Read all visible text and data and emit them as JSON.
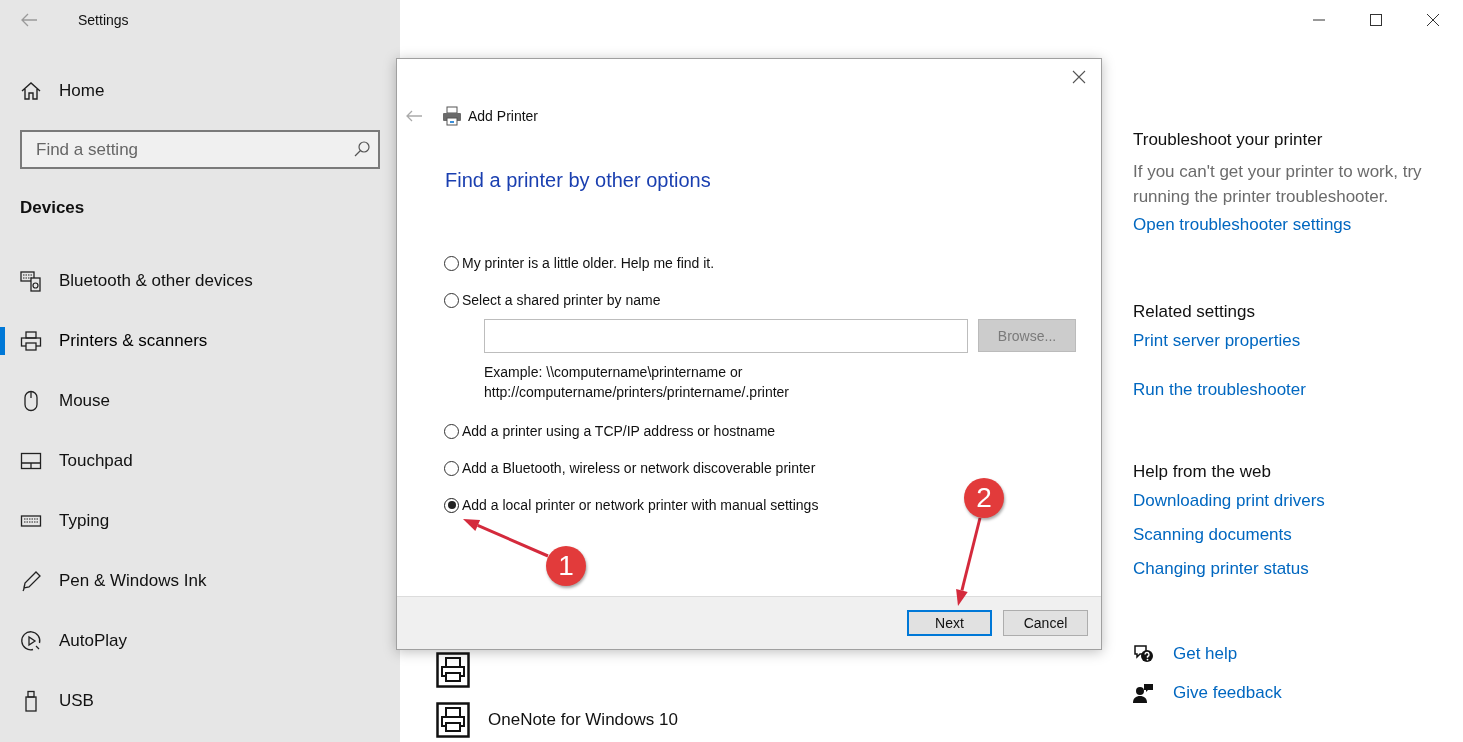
{
  "window": {
    "title": "Settings"
  },
  "sidebar": {
    "home": "Home",
    "search": {
      "placeholder": "Find a setting"
    },
    "section": "Devices",
    "items": [
      {
        "label": "Bluetooth & other devices",
        "selected": false
      },
      {
        "label": "Printers & scanners",
        "selected": true
      },
      {
        "label": "Mouse",
        "selected": false
      },
      {
        "label": "Touchpad",
        "selected": false
      },
      {
        "label": "Typing",
        "selected": false
      },
      {
        "label": "Pen & Windows Ink",
        "selected": false
      },
      {
        "label": "AutoPlay",
        "selected": false
      },
      {
        "label": "USB",
        "selected": false
      }
    ]
  },
  "printers": [
    {
      "kind": "covered"
    },
    {
      "kind": "listed",
      "name": "OneNote for Windows 10"
    }
  ],
  "right_panel": {
    "sections": [
      {
        "heading": "Troubleshoot your printer",
        "text": "If you can't get your printer to work, try running the printer troubleshooter.",
        "links": [
          "Open troubleshooter settings"
        ]
      },
      {
        "heading": "Related settings",
        "links": [
          "Print server properties",
          "Run the troubleshooter"
        ]
      },
      {
        "heading": "Help from the web",
        "links": [
          "Downloading print drivers",
          "Scanning documents",
          "Changing printer status"
        ]
      }
    ],
    "help": [
      {
        "label": "Get help"
      },
      {
        "label": "Give feedback"
      }
    ]
  },
  "dialog": {
    "title": "Add Printer",
    "heading": "Find a printer by other options",
    "options": [
      {
        "kind": "radio",
        "label": "My printer is a little older. Help me find it.",
        "selected": false
      },
      {
        "kind": "radio_with_field",
        "label": "Select a shared printer by name",
        "selected": false,
        "browse": {
          "label": "Browse...",
          "disabled": true
        },
        "example": [
          "Example: \\\\computername\\printername or",
          "http://computername/printers/printername/.printer"
        ]
      },
      {
        "kind": "radio",
        "label": "Add a printer using a TCP/IP address or hostname",
        "selected": false
      },
      {
        "kind": "radio",
        "label": "Add a Bluetooth, wireless or network discoverable printer",
        "selected": false
      },
      {
        "kind": "radio",
        "label": "Add a local printer or network printer with manual settings",
        "selected": true
      }
    ],
    "buttons": [
      {
        "label": "Next",
        "default": true
      },
      {
        "label": "Cancel",
        "default": false
      }
    ]
  },
  "annotations": [
    {
      "label": "1"
    },
    {
      "label": "2"
    }
  ]
}
